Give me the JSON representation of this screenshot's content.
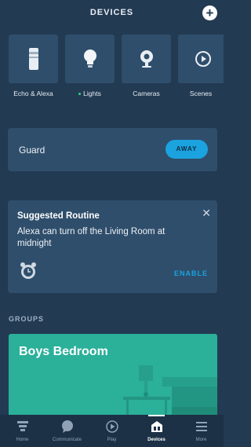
{
  "header": {
    "title": "DEVICES",
    "add_label": "+"
  },
  "categories": [
    {
      "label": "Echo & Alexa",
      "icon": "echo-device-icon"
    },
    {
      "label": "Lights",
      "icon": "lightbulb-icon",
      "status_color": "#33d17a"
    },
    {
      "label": "Cameras",
      "icon": "camera-icon"
    },
    {
      "label": "Scenes",
      "icon": "scenes-play-icon"
    }
  ],
  "guard": {
    "label": "Guard",
    "mode": "AWAY"
  },
  "routine": {
    "title": "Suggested Routine",
    "body": "Alexa can turn off the Living Room at midnight",
    "action": "ENABLE",
    "close": "✕"
  },
  "groups": {
    "heading": "GROUPS",
    "items": [
      {
        "name": "Boys Bedroom",
        "color": "#2bb09a"
      }
    ]
  },
  "nav": [
    {
      "label": "Home",
      "icon": "home-icon"
    },
    {
      "label": "Communicate",
      "icon": "chat-bubble-icon"
    },
    {
      "label": "Play",
      "icon": "play-icon"
    },
    {
      "label": "Devices",
      "icon": "devices-icon",
      "active": true
    },
    {
      "label": "More",
      "icon": "menu-icon"
    }
  ],
  "colors": {
    "background": "#223a52",
    "card": "#2f4e6b",
    "accent": "#1aa3de",
    "nav": "#1d3146"
  }
}
